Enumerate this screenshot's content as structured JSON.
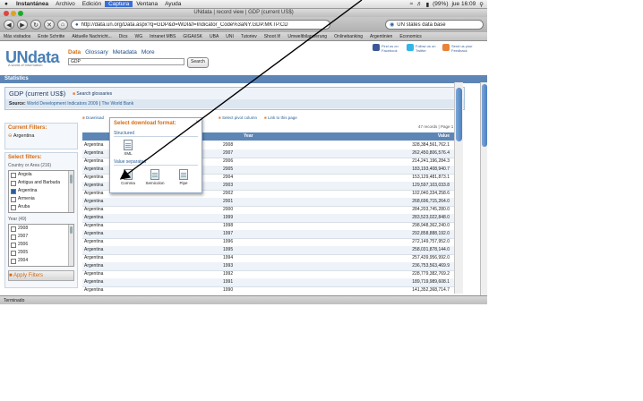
{
  "menubar": {
    "items": [
      "Instantánea",
      "Archivo",
      "Edición",
      "Captura",
      "Ventana",
      "Ayuda"
    ],
    "selected": "Captura",
    "battery": "(99%)",
    "clock": "jue 16:09"
  },
  "window": {
    "title": "UNdata | record view | GDP (current US$)"
  },
  "toolbar": {
    "url": "http://data.un.org/Data.aspx?q=GDP&d=WDI&f=Indicator_Code%3aNY.GDP.MKTP.CD",
    "search_value": "UN states data base"
  },
  "bookmarks": [
    "Más visitados",
    "Erste Schritte",
    "Aktuelle Nachricht...",
    "Dics",
    "WG",
    "Intranet MBS",
    "GIGA/iSK",
    "UBA",
    "UNI",
    "Tutoriev",
    "Shoot It!",
    "Umweltbilanzierung",
    "Onlinebanking",
    "Argentinien",
    "Economics"
  ],
  "site": {
    "logo": "UNdata",
    "tagline": "A world of information",
    "nav": [
      "Data",
      "Glossary",
      "Metadata",
      "More"
    ],
    "search_value": "GDP",
    "search_button": "Search",
    "social": [
      {
        "label": "Find us on Facebook",
        "color": "#3b5998"
      },
      {
        "label": "Follow us on Twitter",
        "color": "#33b5e5"
      },
      {
        "label": "Send us your Feedback",
        "color": "#e8833a"
      }
    ],
    "section": "Statistics",
    "dataset_title": "GDP (current US$)",
    "glossary_link": "Search glossaries",
    "source_label": "Source:",
    "source_1": "World Development Indicators 2009",
    "source_sep": "|",
    "source_2": "The World Bank"
  },
  "filters": {
    "current_title": "Current Filters:",
    "current_value": "Argentina",
    "select_title": "Select filters:",
    "country_title": "Country or Area (216)",
    "countries": [
      {
        "name": "Angola",
        "checked": false
      },
      {
        "name": "Antigua and Barbuda",
        "checked": false
      },
      {
        "name": "Argentina",
        "checked": true
      },
      {
        "name": "Armenia",
        "checked": false
      },
      {
        "name": "Aruba",
        "checked": false
      }
    ],
    "year_title": "Year (49)",
    "years": [
      {
        "name": "2008",
        "checked": false
      },
      {
        "name": "2007",
        "checked": false
      },
      {
        "name": "2006",
        "checked": false
      },
      {
        "name": "2005",
        "checked": false
      },
      {
        "name": "2004",
        "checked": false
      }
    ],
    "apply": "Apply Filters"
  },
  "actions": {
    "download": "Download",
    "select_pivot": "Select pivot column",
    "link": "Link to this page",
    "records": "47 records | Page 1 of 1"
  },
  "table": {
    "headers": [
      "Year",
      "Value"
    ],
    "rows": [
      [
        "Argentina",
        "2008",
        "328,384,561,762.1"
      ],
      [
        "Argentina",
        "2007",
        "262,450,806,576.4"
      ],
      [
        "Argentina",
        "2006",
        "214,241,196,284.3"
      ],
      [
        "Argentina",
        "2005",
        "183,193,408,940.7"
      ],
      [
        "Argentina",
        "2004",
        "153,129,481,873.1"
      ],
      [
        "Argentina",
        "2003",
        "129,597,103,033.8"
      ],
      [
        "Argentina",
        "2002",
        "102,040,334,258.6"
      ],
      [
        "Argentina",
        "2001",
        "268,696,715,264.0"
      ],
      [
        "Argentina",
        "2000",
        "284,203,745,280.0"
      ],
      [
        "Argentina",
        "1999",
        "283,523,022,848.0"
      ],
      [
        "Argentina",
        "1998",
        "298,948,362,240.0"
      ],
      [
        "Argentina",
        "1997",
        "292,858,888,192.0"
      ],
      [
        "Argentina",
        "1996",
        "272,149,757,952.0"
      ],
      [
        "Argentina",
        "1995",
        "258,031,878,144.0"
      ],
      [
        "Argentina",
        "1994",
        "257,439,956,992.0"
      ],
      [
        "Argentina",
        "1993",
        "236,753,563,469.9"
      ],
      [
        "Argentina",
        "1992",
        "228,779,382,769.2"
      ],
      [
        "Argentina",
        "1991",
        "189,719,989,608.1"
      ],
      [
        "Argentina",
        "1990",
        "141,352,368,714.7"
      ]
    ]
  },
  "popup": {
    "title": "Select download format:",
    "close": "×",
    "structured": "Structured",
    "xml": "XML",
    "value_sep": "Value separated",
    "comma": "Comma",
    "semicolon": "Semicolon",
    "pipe": "Pipe"
  },
  "status": "Terminado"
}
